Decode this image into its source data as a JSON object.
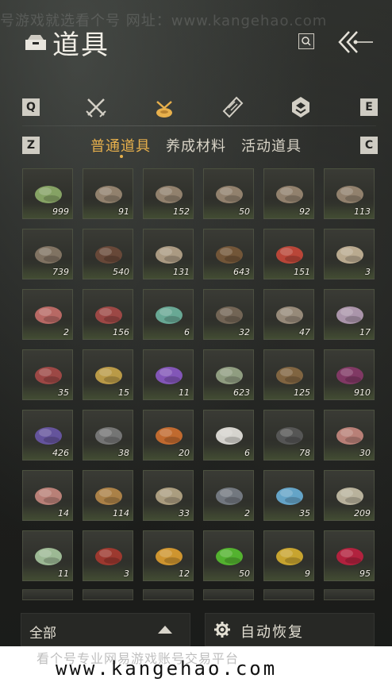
{
  "watermark": {
    "top": "号游戏就选看个号 网址：www.kangehao.com",
    "bottom_left": "看个号专业网易游戏账号交易平台",
    "bottom_url": "www.kangehao.com"
  },
  "header": {
    "title": "道具"
  },
  "category_keys": {
    "prev": "Q",
    "next": "E",
    "sub_prev": "Z",
    "sub_next": "C"
  },
  "category_icons": [
    "crossed-swords-icon",
    "bag-icon",
    "scroll-icon",
    "badge-icon"
  ],
  "subtabs": [
    {
      "label": "普通道具",
      "active": true
    },
    {
      "label": "养成材料",
      "active": false
    },
    {
      "label": "活动道具",
      "active": false
    }
  ],
  "items": [
    {
      "icon": "bamboo-bundle-icon",
      "count": "999"
    },
    {
      "icon": "log-bundle-icon",
      "count": "91"
    },
    {
      "icon": "log-bundle-icon",
      "count": "152"
    },
    {
      "icon": "log-bundle-icon",
      "count": "50"
    },
    {
      "icon": "log-bundle-icon",
      "count": "92"
    },
    {
      "icon": "log-bundle-icon",
      "count": "113"
    },
    {
      "icon": "wood-chunk-icon",
      "count": "739"
    },
    {
      "icon": "feather-icon",
      "count": "540"
    },
    {
      "icon": "mushroom-icon",
      "count": "131"
    },
    {
      "icon": "insect-icon",
      "count": "643"
    },
    {
      "icon": "berry-icon",
      "count": "151"
    },
    {
      "icon": "eggs-icon",
      "count": "3"
    },
    {
      "icon": "raw-meat-icon",
      "count": "2"
    },
    {
      "icon": "steak-icon",
      "count": "156"
    },
    {
      "icon": "jade-stone-icon",
      "count": "6"
    },
    {
      "icon": "feathers-icon",
      "count": "32"
    },
    {
      "icon": "fur-pelt-icon",
      "count": "47"
    },
    {
      "icon": "silk-cloth-icon",
      "count": "17"
    },
    {
      "icon": "steak-icon",
      "count": "35"
    },
    {
      "icon": "fish-icon",
      "count": "15"
    },
    {
      "icon": "amethyst-icon",
      "count": "11"
    },
    {
      "icon": "herb-flower-icon",
      "count": "623"
    },
    {
      "icon": "spice-bowl-icon",
      "count": "125"
    },
    {
      "icon": "purple-flower-icon",
      "count": "910"
    },
    {
      "icon": "lavender-icon",
      "count": "426"
    },
    {
      "icon": "dark-herb-icon",
      "count": "38"
    },
    {
      "icon": "orange-flower-icon",
      "count": "20"
    },
    {
      "icon": "white-feather-icon",
      "count": "6"
    },
    {
      "icon": "dark-branch-icon",
      "count": "78"
    },
    {
      "icon": "meat-slice-icon",
      "count": "30"
    },
    {
      "icon": "meat-slice-icon",
      "count": "14"
    },
    {
      "icon": "fur-icon",
      "count": "114"
    },
    {
      "icon": "pufferfish-icon",
      "count": "33"
    },
    {
      "icon": "iron-ore-icon",
      "count": "2"
    },
    {
      "icon": "blue-crystal-icon",
      "count": "35"
    },
    {
      "icon": "ribcage-bone-icon",
      "count": "209"
    },
    {
      "icon": "melon-icon",
      "count": "11"
    },
    {
      "icon": "red-coral-icon",
      "count": "3"
    },
    {
      "icon": "sparkler-icon",
      "count": "12"
    },
    {
      "icon": "green-orb-icon",
      "count": "50"
    },
    {
      "icon": "gold-nugget-icon",
      "count": "9"
    },
    {
      "icon": "ruby-ore-icon",
      "count": "95"
    }
  ],
  "bottom": {
    "filter_label": "全部",
    "auto_label": "自动恢复"
  }
}
